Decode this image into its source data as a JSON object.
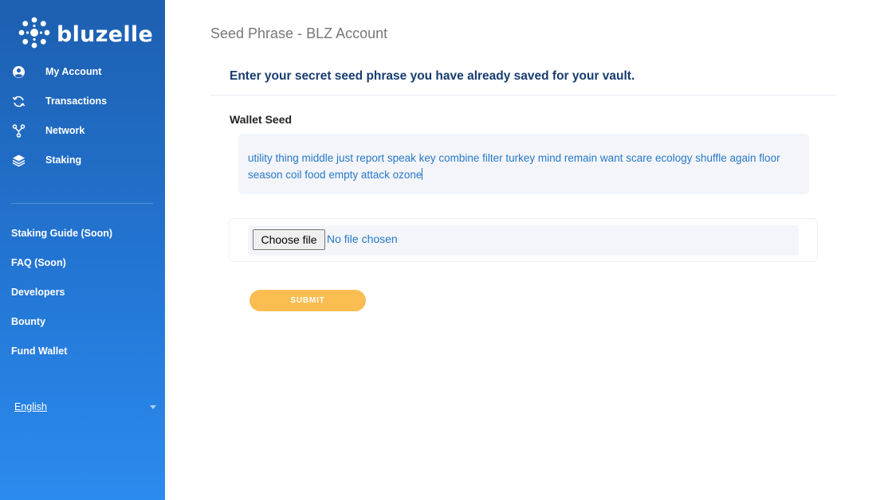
{
  "brand": {
    "name": "bluzelle"
  },
  "sidebar": {
    "nav": [
      {
        "label": "My Account",
        "icon": "user-circle-icon"
      },
      {
        "label": "Transactions",
        "icon": "refresh-icon"
      },
      {
        "label": "Network",
        "icon": "network-icon"
      },
      {
        "label": "Staking",
        "icon": "layers-icon"
      }
    ],
    "links": [
      {
        "label": "Staking Guide (Soon)"
      },
      {
        "label": "FAQ (Soon)"
      },
      {
        "label": "Developers"
      },
      {
        "label": "Bounty"
      },
      {
        "label": "Fund Wallet"
      }
    ],
    "language": "English"
  },
  "main": {
    "page_title": "Seed Phrase - BLZ Account",
    "heading": "Enter your secret seed phrase you have already saved for your vault.",
    "field_label": "Wallet Seed",
    "seed_value": "utility thing middle just report speak key combine filter turkey mind remain want scare ecology shuffle again floor season coil food empty attack ozone",
    "file_button": "Choose file",
    "file_status": "No file chosen",
    "submit_label": "SUBMIT"
  },
  "colors": {
    "sidebar_top": "#1d5fb0",
    "sidebar_bottom": "#2c8bee",
    "heading": "#173c6f",
    "link_blue": "#2878c8",
    "submit": "#f9bd52"
  }
}
